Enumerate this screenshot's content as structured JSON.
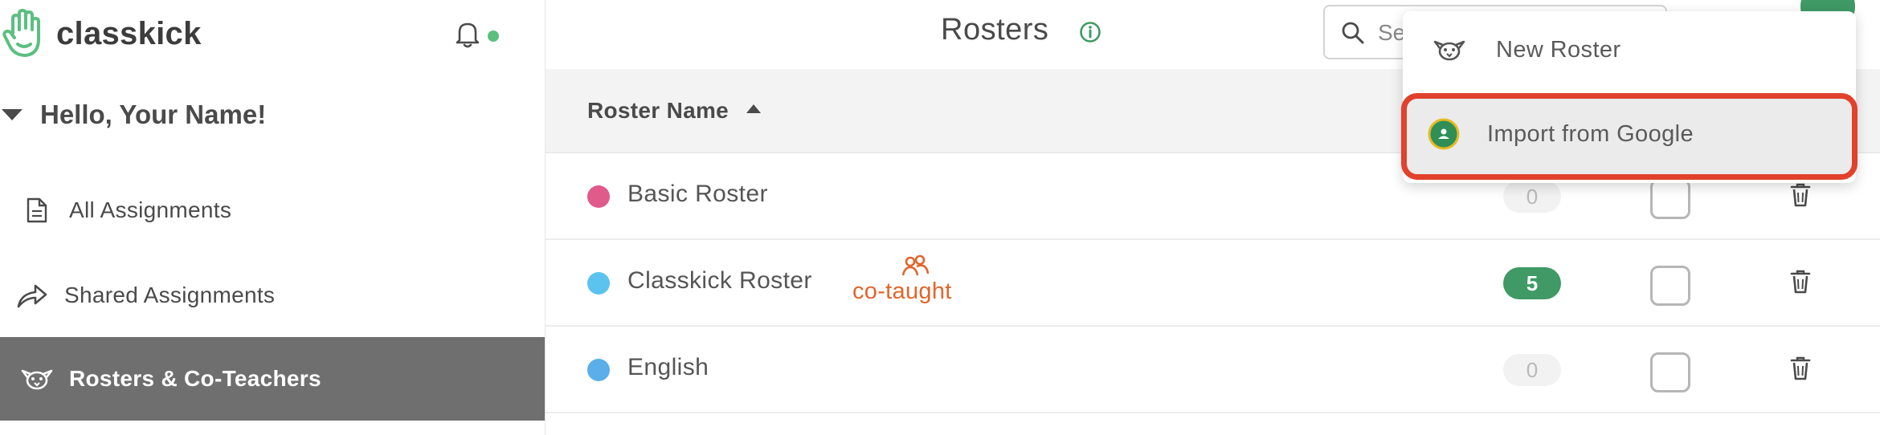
{
  "app": {
    "brand": "classkick",
    "greeting": "Hello, Your Name!"
  },
  "sidebar": {
    "items": [
      {
        "label": "All Assignments",
        "icon": "document-icon"
      },
      {
        "label": "Shared Assignments",
        "icon": "share-arrow-icon"
      },
      {
        "label": "Rosters & Co-Teachers",
        "icon": "roster-bird-icon",
        "active": true
      }
    ]
  },
  "header": {
    "title": "Rosters",
    "search_value": "Se"
  },
  "table": {
    "columns": [
      "Roster Name"
    ],
    "sort": "ascending",
    "rows": [
      {
        "name": "Basic Roster",
        "color": "#e05a8a",
        "count": "0",
        "cotaught": false
      },
      {
        "name": "Classkick Roster",
        "color": "#5bc3ee",
        "count": "5",
        "cotaught": true
      },
      {
        "name": "English",
        "color": "#5aaeea",
        "count": "0",
        "cotaught": false
      }
    ],
    "cotaught_label": "co-taught"
  },
  "dropdown": {
    "items": [
      {
        "label": "New Roster",
        "icon": "roster-bird-icon"
      },
      {
        "label": "Import from Google",
        "icon": "google-classroom-icon",
        "highlighted": true
      }
    ]
  },
  "colors": {
    "accent_green": "#3f9a65",
    "highlight_red": "#e2412b",
    "cotaught_orange": "#e0662c",
    "sidebar_active": "#6f6f70"
  }
}
